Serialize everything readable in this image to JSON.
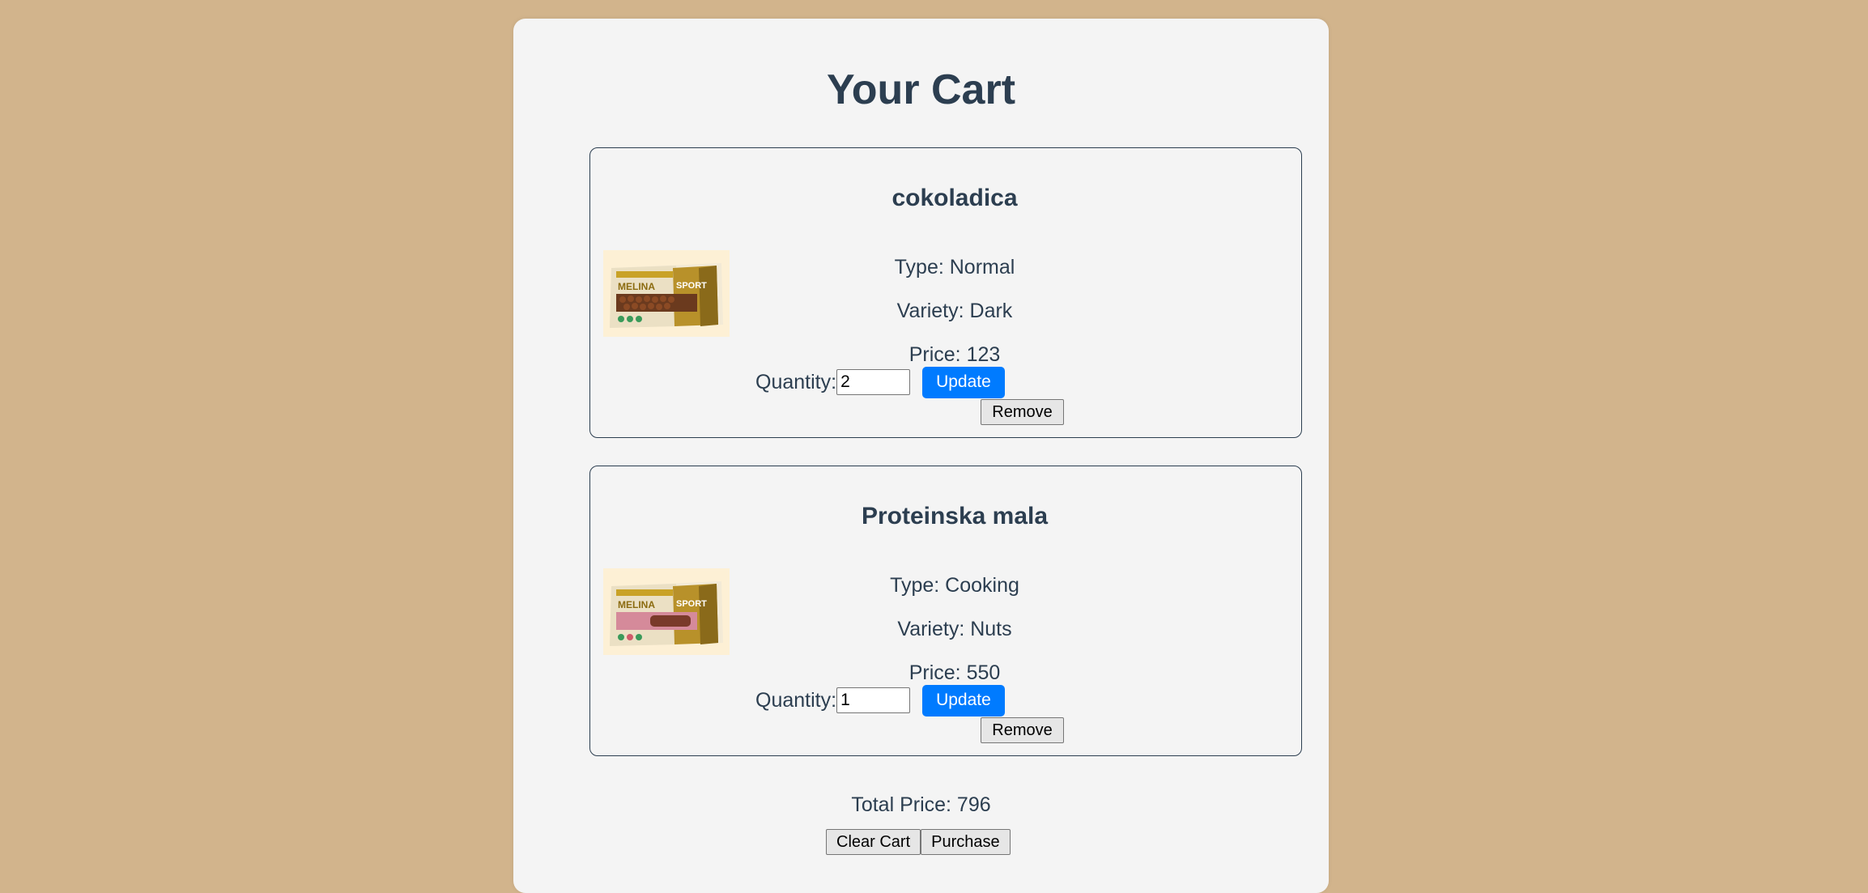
{
  "page": {
    "title": "Your Cart",
    "background_color": "#d2b48c",
    "panel_color": "#f4f4f4",
    "text_color": "#2c3e50",
    "accent_color": "#007bff"
  },
  "cart": {
    "items": [
      {
        "name": "cokoladica",
        "type": "Type: Normal",
        "variety": "Variety: Dark",
        "price": "Price: 123",
        "quantity_label": "Quantity:",
        "quantity": "2",
        "update_label": "Update",
        "remove_label": "Remove",
        "image_icon": "chocolate-bar-product-image"
      },
      {
        "name": "Proteinska mala",
        "type": "Type: Cooking",
        "variety": "Variety: Nuts",
        "price": "Price: 550",
        "quantity_label": "Quantity:",
        "quantity": "1",
        "update_label": "Update",
        "remove_label": "Remove",
        "image_icon": "protein-bar-product-image"
      }
    ],
    "total_price": "Total Price: 796",
    "clear_label": "Clear Cart",
    "purchase_label": "Purchase"
  }
}
